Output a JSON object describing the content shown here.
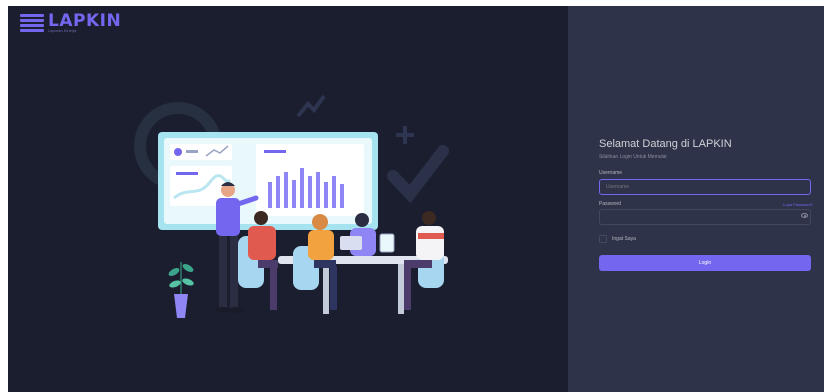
{
  "brand": {
    "name": "LAPKIN",
    "tagline": "Laporan Kinerja"
  },
  "login": {
    "title": "Selamat Datang di LAPKIN",
    "subtitle": "Silahkan Login Untuk Memulai",
    "username_label": "Username",
    "username_placeholder": "Username",
    "password_label": "Password",
    "forgot_link": "Lupa Password?",
    "remember_label": "Ingat Saya",
    "login_button": "Login"
  },
  "colors": {
    "primary": "#7367f0",
    "left_bg": "#1b1e2f",
    "right_bg": "#2f3349"
  },
  "icons": [
    "logo-icon",
    "eye-icon",
    "plus-icon",
    "check-icon",
    "plant-icon"
  ]
}
